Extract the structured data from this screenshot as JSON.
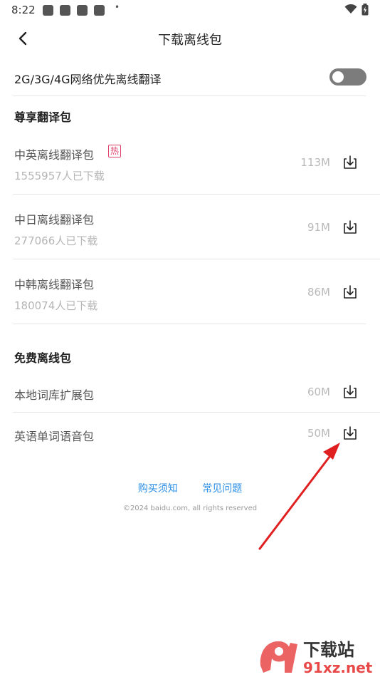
{
  "status_bar": {
    "time": "8:22",
    "dot": "•"
  },
  "header": {
    "title": "下载离线包"
  },
  "settings": {
    "toggle_label": "2G/3G/4G网络优先离线翻译",
    "toggle_on": false
  },
  "sections": [
    {
      "title": "尊享翻译包",
      "items": [
        {
          "name": "中英离线翻译包",
          "badge": "热",
          "downloads": "1555957人已下载",
          "size": "113M"
        },
        {
          "name": "中日离线翻译包",
          "downloads": "277066人已下载",
          "size": "91M"
        },
        {
          "name": "中韩离线翻译包",
          "downloads": "180074人已下载",
          "size": "86M"
        }
      ]
    },
    {
      "title": "免费离线包",
      "items": [
        {
          "name": "本地词库扩展包",
          "size": "60M"
        },
        {
          "name": "英语单词语音包",
          "size": "50M"
        }
      ]
    }
  ],
  "footer": {
    "link_purchase": "购买须知",
    "link_faq": "常见问题",
    "copyright": "©2024 baidu.com, all rights reserved"
  },
  "watermark": {
    "text_cn": "下载站",
    "text_en": "91xz.net"
  },
  "colors": {
    "accent_link": "#2a8ee6",
    "hot_badge": "#e0406a",
    "annotation_arrow": "#e02020",
    "toggle_off": "#7c7c7c"
  }
}
